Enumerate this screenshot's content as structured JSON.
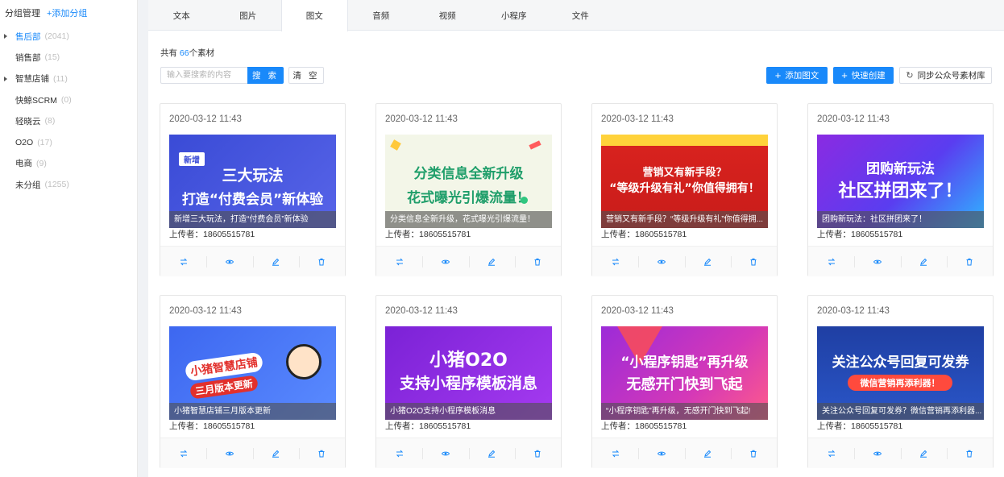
{
  "sidebar": {
    "title": "分组管理",
    "add_group": "+添加分组",
    "items": [
      {
        "label": "售后部",
        "count": "(2041)"
      },
      {
        "label": "销售部",
        "count": "(15)"
      },
      {
        "label": "智慧店铺",
        "count": "(11)"
      },
      {
        "label": "快鲸SCRM",
        "count": "(0)"
      },
      {
        "label": "轻晓云",
        "count": "(8)"
      },
      {
        "label": "O2O",
        "count": "(17)"
      },
      {
        "label": "电商",
        "count": "(9)"
      },
      {
        "label": "未分组",
        "count": "(1255)"
      }
    ]
  },
  "tabs": [
    "文本",
    "图片",
    "图文",
    "音频",
    "视频",
    "小程序",
    "文件"
  ],
  "total": {
    "prefix": "共有 ",
    "count": "66",
    "suffix": "个素材"
  },
  "search": {
    "placeholder": "输入要搜索的内容",
    "search_label": "搜 索",
    "clear_label": "清 空"
  },
  "actions": {
    "add_news": "添加图文",
    "quick_create": "快速创建",
    "sync": "同步公众号素材库"
  },
  "cards": [
    {
      "date": "2020-03-12 11:43",
      "caption": "新增三大玩法，打造“付费会员”新体验",
      "uploader": "上传者：18605515781",
      "art": {
        "badge": "新增",
        "line1": "三大玩法",
        "line2": "打造“付费会员”新体验"
      }
    },
    {
      "date": "2020-03-12 11:43",
      "caption": "分类信息全新升级，花式曝光引爆流量！",
      "uploader": "上传者：18605515781",
      "art": {
        "line1": "分类信息全新升级",
        "line2": "花式曝光引爆流量！"
      }
    },
    {
      "date": "2020-03-12 11:43",
      "caption": "营销又有新手段？“等级升级有礼”你值得拥...",
      "uploader": "上传者：18605515781",
      "art": {
        "line1": "营销又有新手段？",
        "line2": "“等级升级有礼”你值得拥有！"
      }
    },
    {
      "date": "2020-03-12 11:43",
      "caption": "团购新玩法：社区拼团来了！",
      "uploader": "上传者：18605515781",
      "art": {
        "line1": "团购新玩法",
        "line2": "社区拼团来了！"
      }
    },
    {
      "date": "2020-03-12 11:43",
      "caption": "小猪智慧店铺三月版本更新",
      "uploader": "上传者：18605515781",
      "art": {
        "line1": "小猪智慧店铺",
        "line2": "三月版本更新"
      }
    },
    {
      "date": "2020-03-12 11:43",
      "caption": "小猪O2O支持小程序模板消息",
      "uploader": "上传者：18605515781",
      "art": {
        "line1": "小猪O2O",
        "line2": "支持小程序模板消息"
      }
    },
    {
      "date": "2020-03-12 11:43",
      "caption": "“小程序钥匙”再升级，无感开门快到飞起!",
      "uploader": "上传者：18605515781",
      "art": {
        "line1": "“小程序钥匙”再升级",
        "line2": "无感开门快到飞起"
      }
    },
    {
      "date": "2020-03-12 11:43",
      "caption": "关注公众号回复可发券？微信营销再添利器...",
      "uploader": "上传者：18605515781",
      "art": {
        "line1": "关注公众号回复可发券",
        "line2": "微信营销再添利器！"
      }
    }
  ],
  "colors": {
    "accent": "#1989fa"
  }
}
